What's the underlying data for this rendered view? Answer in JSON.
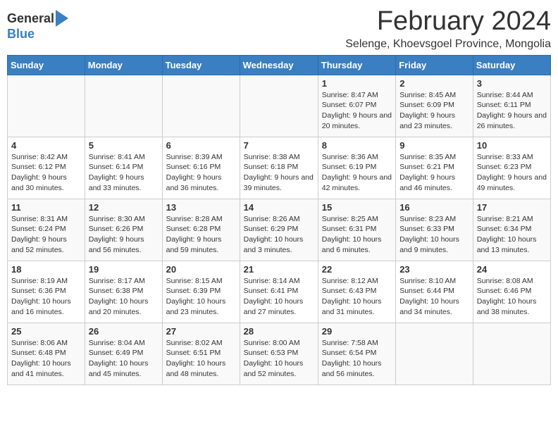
{
  "logo": {
    "general": "General",
    "blue": "Blue"
  },
  "title": "February 2024",
  "subtitle": "Selenge, Khoevsgoel Province, Mongolia",
  "headers": [
    "Sunday",
    "Monday",
    "Tuesday",
    "Wednesday",
    "Thursday",
    "Friday",
    "Saturday"
  ],
  "weeks": [
    [
      {
        "day": "",
        "text": ""
      },
      {
        "day": "",
        "text": ""
      },
      {
        "day": "",
        "text": ""
      },
      {
        "day": "",
        "text": ""
      },
      {
        "day": "1",
        "text": "Sunrise: 8:47 AM\nSunset: 6:07 PM\nDaylight: 9 hours and 20 minutes."
      },
      {
        "day": "2",
        "text": "Sunrise: 8:45 AM\nSunset: 6:09 PM\nDaylight: 9 hours and 23 minutes."
      },
      {
        "day": "3",
        "text": "Sunrise: 8:44 AM\nSunset: 6:11 PM\nDaylight: 9 hours and 26 minutes."
      }
    ],
    [
      {
        "day": "4",
        "text": "Sunrise: 8:42 AM\nSunset: 6:12 PM\nDaylight: 9 hours and 30 minutes."
      },
      {
        "day": "5",
        "text": "Sunrise: 8:41 AM\nSunset: 6:14 PM\nDaylight: 9 hours and 33 minutes."
      },
      {
        "day": "6",
        "text": "Sunrise: 8:39 AM\nSunset: 6:16 PM\nDaylight: 9 hours and 36 minutes."
      },
      {
        "day": "7",
        "text": "Sunrise: 8:38 AM\nSunset: 6:18 PM\nDaylight: 9 hours and 39 minutes."
      },
      {
        "day": "8",
        "text": "Sunrise: 8:36 AM\nSunset: 6:19 PM\nDaylight: 9 hours and 42 minutes."
      },
      {
        "day": "9",
        "text": "Sunrise: 8:35 AM\nSunset: 6:21 PM\nDaylight: 9 hours and 46 minutes."
      },
      {
        "day": "10",
        "text": "Sunrise: 8:33 AM\nSunset: 6:23 PM\nDaylight: 9 hours and 49 minutes."
      }
    ],
    [
      {
        "day": "11",
        "text": "Sunrise: 8:31 AM\nSunset: 6:24 PM\nDaylight: 9 hours and 52 minutes."
      },
      {
        "day": "12",
        "text": "Sunrise: 8:30 AM\nSunset: 6:26 PM\nDaylight: 9 hours and 56 minutes."
      },
      {
        "day": "13",
        "text": "Sunrise: 8:28 AM\nSunset: 6:28 PM\nDaylight: 9 hours and 59 minutes."
      },
      {
        "day": "14",
        "text": "Sunrise: 8:26 AM\nSunset: 6:29 PM\nDaylight: 10 hours and 3 minutes."
      },
      {
        "day": "15",
        "text": "Sunrise: 8:25 AM\nSunset: 6:31 PM\nDaylight: 10 hours and 6 minutes."
      },
      {
        "day": "16",
        "text": "Sunrise: 8:23 AM\nSunset: 6:33 PM\nDaylight: 10 hours and 9 minutes."
      },
      {
        "day": "17",
        "text": "Sunrise: 8:21 AM\nSunset: 6:34 PM\nDaylight: 10 hours and 13 minutes."
      }
    ],
    [
      {
        "day": "18",
        "text": "Sunrise: 8:19 AM\nSunset: 6:36 PM\nDaylight: 10 hours and 16 minutes."
      },
      {
        "day": "19",
        "text": "Sunrise: 8:17 AM\nSunset: 6:38 PM\nDaylight: 10 hours and 20 minutes."
      },
      {
        "day": "20",
        "text": "Sunrise: 8:15 AM\nSunset: 6:39 PM\nDaylight: 10 hours and 23 minutes."
      },
      {
        "day": "21",
        "text": "Sunrise: 8:14 AM\nSunset: 6:41 PM\nDaylight: 10 hours and 27 minutes."
      },
      {
        "day": "22",
        "text": "Sunrise: 8:12 AM\nSunset: 6:43 PM\nDaylight: 10 hours and 31 minutes."
      },
      {
        "day": "23",
        "text": "Sunrise: 8:10 AM\nSunset: 6:44 PM\nDaylight: 10 hours and 34 minutes."
      },
      {
        "day": "24",
        "text": "Sunrise: 8:08 AM\nSunset: 6:46 PM\nDaylight: 10 hours and 38 minutes."
      }
    ],
    [
      {
        "day": "25",
        "text": "Sunrise: 8:06 AM\nSunset: 6:48 PM\nDaylight: 10 hours and 41 minutes."
      },
      {
        "day": "26",
        "text": "Sunrise: 8:04 AM\nSunset: 6:49 PM\nDaylight: 10 hours and 45 minutes."
      },
      {
        "day": "27",
        "text": "Sunrise: 8:02 AM\nSunset: 6:51 PM\nDaylight: 10 hours and 48 minutes."
      },
      {
        "day": "28",
        "text": "Sunrise: 8:00 AM\nSunset: 6:53 PM\nDaylight: 10 hours and 52 minutes."
      },
      {
        "day": "29",
        "text": "Sunrise: 7:58 AM\nSunset: 6:54 PM\nDaylight: 10 hours and 56 minutes."
      },
      {
        "day": "",
        "text": ""
      },
      {
        "day": "",
        "text": ""
      }
    ]
  ]
}
